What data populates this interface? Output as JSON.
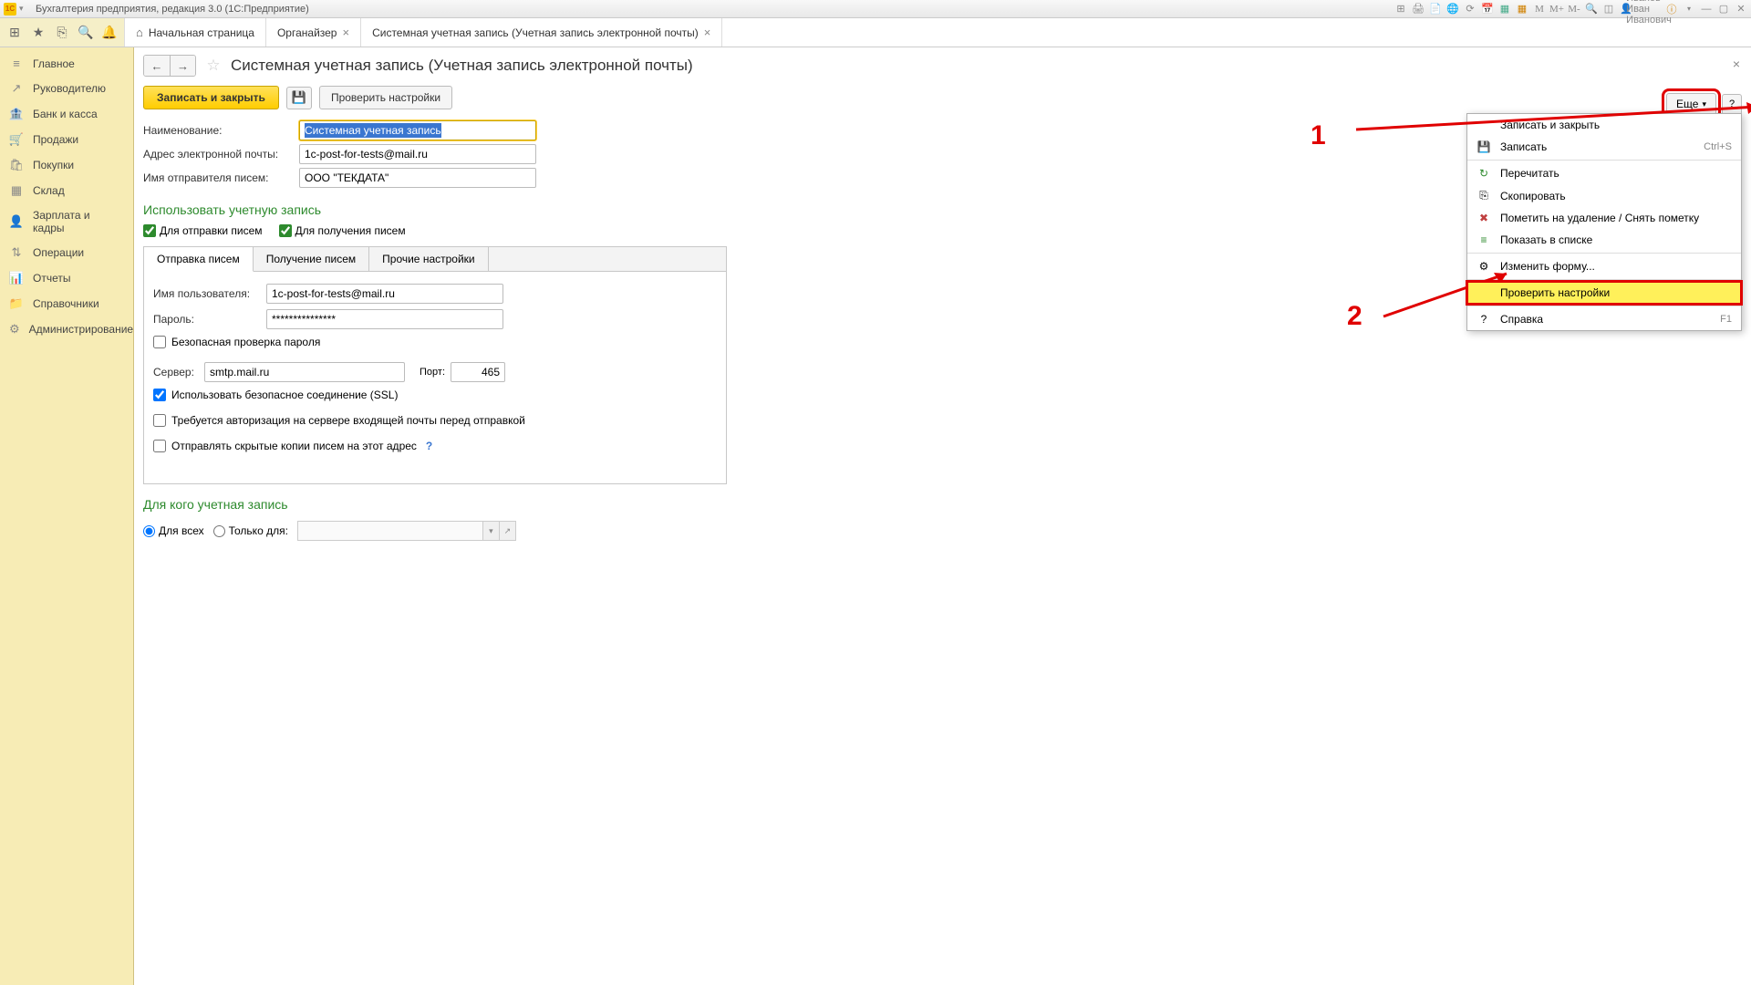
{
  "titlebar": {
    "logo": "1С",
    "title": "Бухгалтерия предприятия, редакция 3.0  (1С:Предприятие)",
    "user": "Иванов Иван Иванович",
    "m_labels": [
      "M",
      "M+",
      "M-"
    ]
  },
  "toolbar_icons": [
    "⊞",
    "★",
    "⎘",
    "🔍",
    "🔔"
  ],
  "tabs": [
    {
      "label": "Начальная страница",
      "closable": false,
      "home": true
    },
    {
      "label": "Органайзер",
      "closable": true
    },
    {
      "label": "Системная учетная запись (Учетная запись электронной почты)",
      "closable": true,
      "active": true
    }
  ],
  "sidebar": [
    {
      "icon": "≡",
      "label": "Главное"
    },
    {
      "icon": "↗",
      "label": "Руководителю"
    },
    {
      "icon": "🏦",
      "label": "Банк и касса"
    },
    {
      "icon": "🛒",
      "label": "Продажи"
    },
    {
      "icon": "🛍",
      "label": "Покупки"
    },
    {
      "icon": "▦",
      "label": "Склад"
    },
    {
      "icon": "👤",
      "label": "Зарплата и кадры"
    },
    {
      "icon": "⇅",
      "label": "Операции"
    },
    {
      "icon": "📊",
      "label": "Отчеты"
    },
    {
      "icon": "📁",
      "label": "Справочники"
    },
    {
      "icon": "⚙",
      "label": "Администрирование"
    }
  ],
  "page": {
    "title": "Системная учетная запись (Учетная запись электронной почты)",
    "actions": {
      "save_close": "Записать и закрыть",
      "check": "Проверить настройки",
      "more": "Еще"
    },
    "labels": {
      "name": "Наименование:",
      "email": "Адрес электронной почты:",
      "sender": "Имя отправителя писем:"
    },
    "values": {
      "name": "Системная учетная запись",
      "email": "1c-post-for-tests@mail.ru",
      "sender": "ООО \"ТЕКДАТА\""
    },
    "section1": "Использовать учетную запись",
    "checks": {
      "send": "Для отправки писем",
      "recv": "Для получения писем"
    },
    "subtabs": [
      "Отправка писем",
      "Получение писем",
      "Прочие настройки"
    ],
    "smtp": {
      "user_label": "Имя пользователя:",
      "user": "1c-post-for-tests@mail.ru",
      "pass_label": "Пароль:",
      "pass": "***************",
      "safe_check": "Безопасная проверка пароля",
      "server_label": "Сервер:",
      "server": "smtp.mail.ru",
      "port_label": "Порт:",
      "port": "465",
      "ssl": "Использовать безопасное соединение (SSL)",
      "auth": "Требуется авторизация на сервере входящей почты перед отправкой",
      "bcc": "Отправлять скрытые копии писем на этот адрес"
    },
    "section2": "Для кого учетная запись",
    "radios": {
      "all": "Для всех",
      "only": "Только для:"
    }
  },
  "dropdown": [
    {
      "icon": "",
      "label": "Записать и закрыть",
      "shortcut": ""
    },
    {
      "icon": "💾",
      "label": "Записать",
      "shortcut": "Ctrl+S",
      "color": "#2265b5"
    },
    {
      "icon": "↻",
      "label": "Перечитать",
      "color": "#2d8a2d"
    },
    {
      "icon": "⎘",
      "label": "Скопировать",
      "color": "#888"
    },
    {
      "icon": "✖",
      "label": "Пометить на удаление / Снять пометку",
      "color": "#c04040"
    },
    {
      "icon": "≡",
      "label": "Показать в списке",
      "color": "#2d8a2d"
    },
    {
      "icon": "⚙",
      "label": "Изменить форму...",
      "color": "#888"
    },
    {
      "icon": "",
      "label": "Проверить настройки",
      "highlighted": true
    },
    {
      "icon": "?",
      "label": "Справка",
      "shortcut": "F1",
      "color": "#555"
    }
  ],
  "annotations": {
    "a1": "1",
    "a2": "2"
  }
}
